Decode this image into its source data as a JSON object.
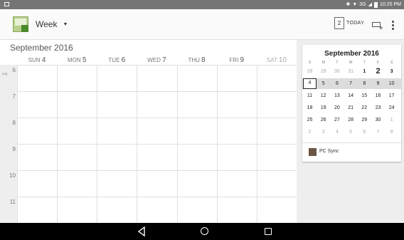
{
  "status_bar": {
    "network": "3G",
    "time": "10:25 PM"
  },
  "toolbar": {
    "view_label": "Week",
    "today_day": "2",
    "today_label": "TODAY"
  },
  "week": {
    "month_label": "September 2016",
    "days": [
      {
        "dow": "SUN",
        "num": "4"
      },
      {
        "dow": "MON",
        "num": "5"
      },
      {
        "dow": "TUE",
        "num": "6"
      },
      {
        "dow": "WED",
        "num": "7"
      },
      {
        "dow": "THU",
        "num": "8"
      },
      {
        "dow": "FRI",
        "num": "9"
      },
      {
        "dow": "SAT",
        "num": "10"
      }
    ],
    "hours": [
      {
        "label": "6",
        "ampm": "PM"
      },
      {
        "label": "7",
        "ampm": ""
      },
      {
        "label": "8",
        "ampm": ""
      },
      {
        "label": "9",
        "ampm": ""
      },
      {
        "label": "10",
        "ampm": ""
      },
      {
        "label": "11",
        "ampm": ""
      }
    ]
  },
  "mini_calendar": {
    "title": "September 2016",
    "dow": [
      "S",
      "M",
      "T",
      "W",
      "T",
      "F",
      "S"
    ],
    "rows": [
      [
        "28",
        "29",
        "30",
        "31",
        "1",
        "2",
        "3"
      ],
      [
        "4",
        "5",
        "6",
        "7",
        "8",
        "9",
        "10"
      ],
      [
        "11",
        "12",
        "13",
        "14",
        "15",
        "16",
        "17"
      ],
      [
        "18",
        "19",
        "20",
        "21",
        "22",
        "23",
        "24"
      ],
      [
        "25",
        "26",
        "27",
        "28",
        "29",
        "30",
        "1"
      ],
      [
        "2",
        "3",
        "4",
        "5",
        "6",
        "7",
        "8"
      ]
    ],
    "highlight_row": 1,
    "selected_date": "4",
    "today_date": "2"
  },
  "calendars": [
    {
      "name": "PC Sync",
      "color": "#6b5544"
    }
  ],
  "colors": {
    "status_bar": "#757575",
    "gutter": "#eeeeee",
    "week_highlight": "#dcdcdc"
  }
}
